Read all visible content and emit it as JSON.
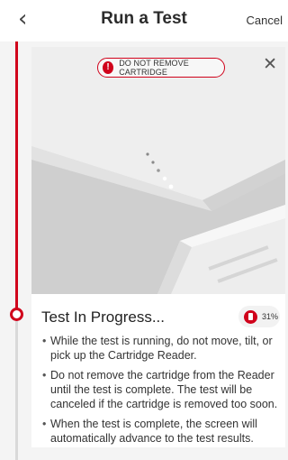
{
  "header": {
    "back_icon": "‹",
    "title": "Run a Test",
    "cancel_label": "Cancel"
  },
  "banner": {
    "warning_icon": "!",
    "warning_text": "DO NOT REMOVE CARTRIDGE",
    "close_icon": "✕"
  },
  "status": {
    "title": "Test In Progress...",
    "progress_label": "31%",
    "progress_value": 31
  },
  "instructions": [
    "While the test is running, do not move, tilt, or pick up the Cartridge Reader.",
    "Do not remove the cartridge from the Reader until the test is complete. The test will be canceled if the cartridge is removed too soon.",
    "When the test is complete, the screen will automatically advance to the test results."
  ],
  "colors": {
    "accent": "#d0021b",
    "rail_inactive": "#d9d9d9",
    "background": "#f4f4f4"
  }
}
